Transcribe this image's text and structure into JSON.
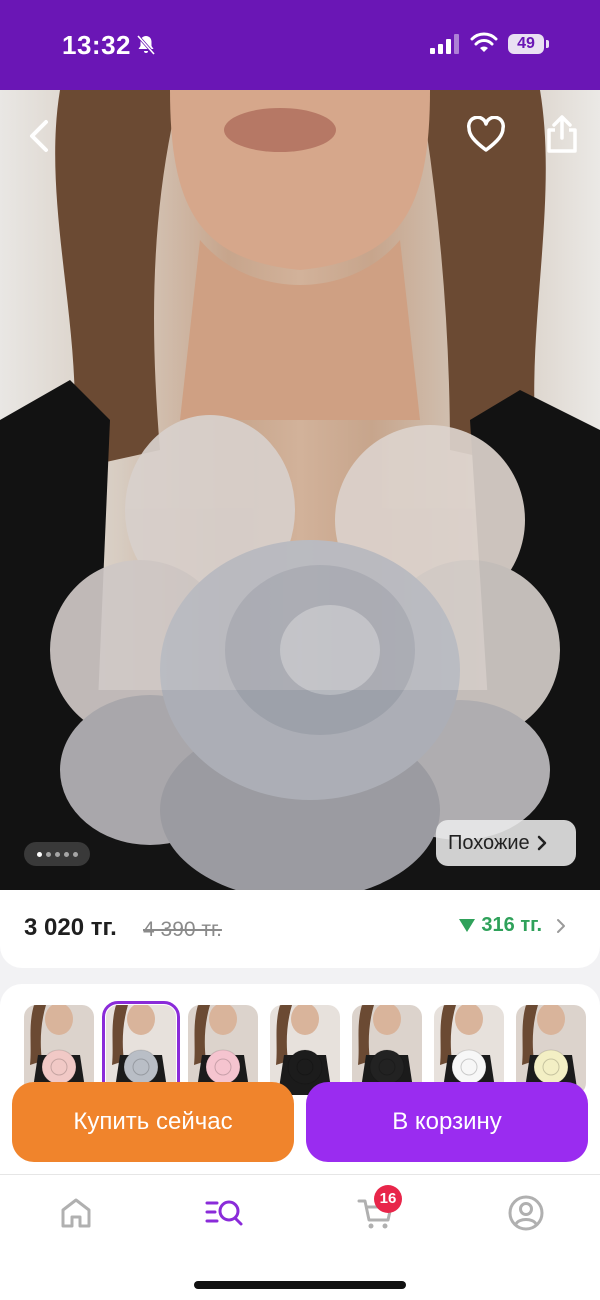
{
  "status_bar": {
    "time": "13:32",
    "battery": "49"
  },
  "product": {
    "price": "3 020 тг.",
    "old_price": "4 390 тг.",
    "discount": "316 тг.",
    "similar_label": "Похожие",
    "image_count": 5,
    "current_image": 1
  },
  "variants": [
    {
      "name": "pink-rose-brooch",
      "flower": "#f1c9c6",
      "selected": false
    },
    {
      "name": "grey-rose-brooch",
      "flower": "#b9bec6",
      "selected": true
    },
    {
      "name": "light-pink-rose-brooch",
      "flower": "#f5c4cf",
      "selected": false
    },
    {
      "name": "black-rose-brooch",
      "flower": "#1c1c1c",
      "selected": false
    },
    {
      "name": "black-rose-brooch-2",
      "flower": "#222222",
      "selected": false
    },
    {
      "name": "white-rose-brooch",
      "flower": "#f7f7f7",
      "selected": false
    },
    {
      "name": "cream-rose-brooch",
      "flower": "#f3efc4",
      "selected": false
    }
  ],
  "actions": {
    "buy_now": "Купить сейчас",
    "add_to_cart": "В корзину"
  },
  "bottom_nav": {
    "cart_count": "16"
  },
  "colors": {
    "brand": "#6a16b5",
    "buy": "#f0842c",
    "cart": "#9a2cf0",
    "discount": "#2fa15a",
    "badge": "#e8264a"
  }
}
